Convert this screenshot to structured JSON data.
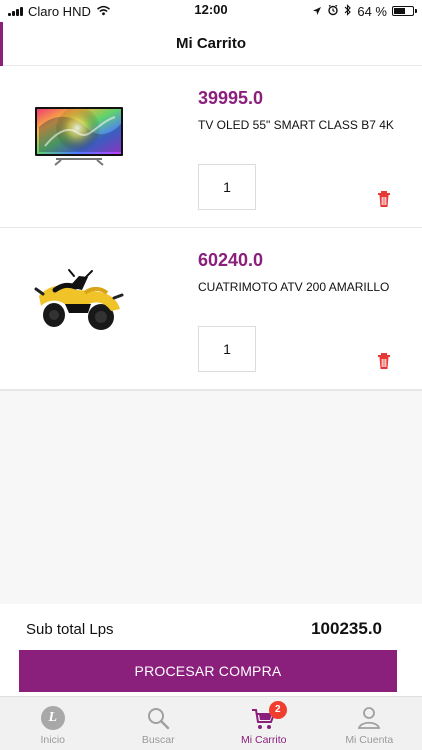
{
  "status_bar": {
    "carrier": "Claro HND",
    "time": "12:00",
    "battery": "64 %",
    "battery_level": 0.64,
    "icons": [
      "signal-icon",
      "wifi-icon",
      "location-icon",
      "alarm-icon",
      "bluetooth-icon",
      "battery-icon"
    ]
  },
  "header": {
    "title": "Mi Carrito"
  },
  "cart": {
    "items": [
      {
        "price": "39995.0",
        "name": "TV OLED 55\" SMART CLASS B7 4K",
        "quantity": "1",
        "image_icon": "tv-image",
        "delete_icon": "trash-icon"
      },
      {
        "price": "60240.0",
        "name": "CUATRIMOTO ATV 200 AMARILLO",
        "quantity": "1",
        "image_icon": "atv-image",
        "delete_icon": "trash-icon"
      }
    ]
  },
  "summary": {
    "subtotal_label": "Sub total Lps",
    "subtotal_value": "100235.0"
  },
  "actions": {
    "checkout_label": "PROCESAR COMPRA"
  },
  "bottom_nav": {
    "tabs": [
      {
        "label": "Inicio",
        "icon": "home-logo-icon",
        "active": false
      },
      {
        "label": "Buscar",
        "icon": "search-icon",
        "active": false
      },
      {
        "label": "Mi Carrito",
        "icon": "cart-icon",
        "active": true,
        "badge": "2"
      },
      {
        "label": "Mi Cuenta",
        "icon": "user-icon",
        "active": false
      }
    ]
  },
  "colors": {
    "brand": "#8b1f7c",
    "danger": "#e53935",
    "badge": "#ef3e2f"
  }
}
